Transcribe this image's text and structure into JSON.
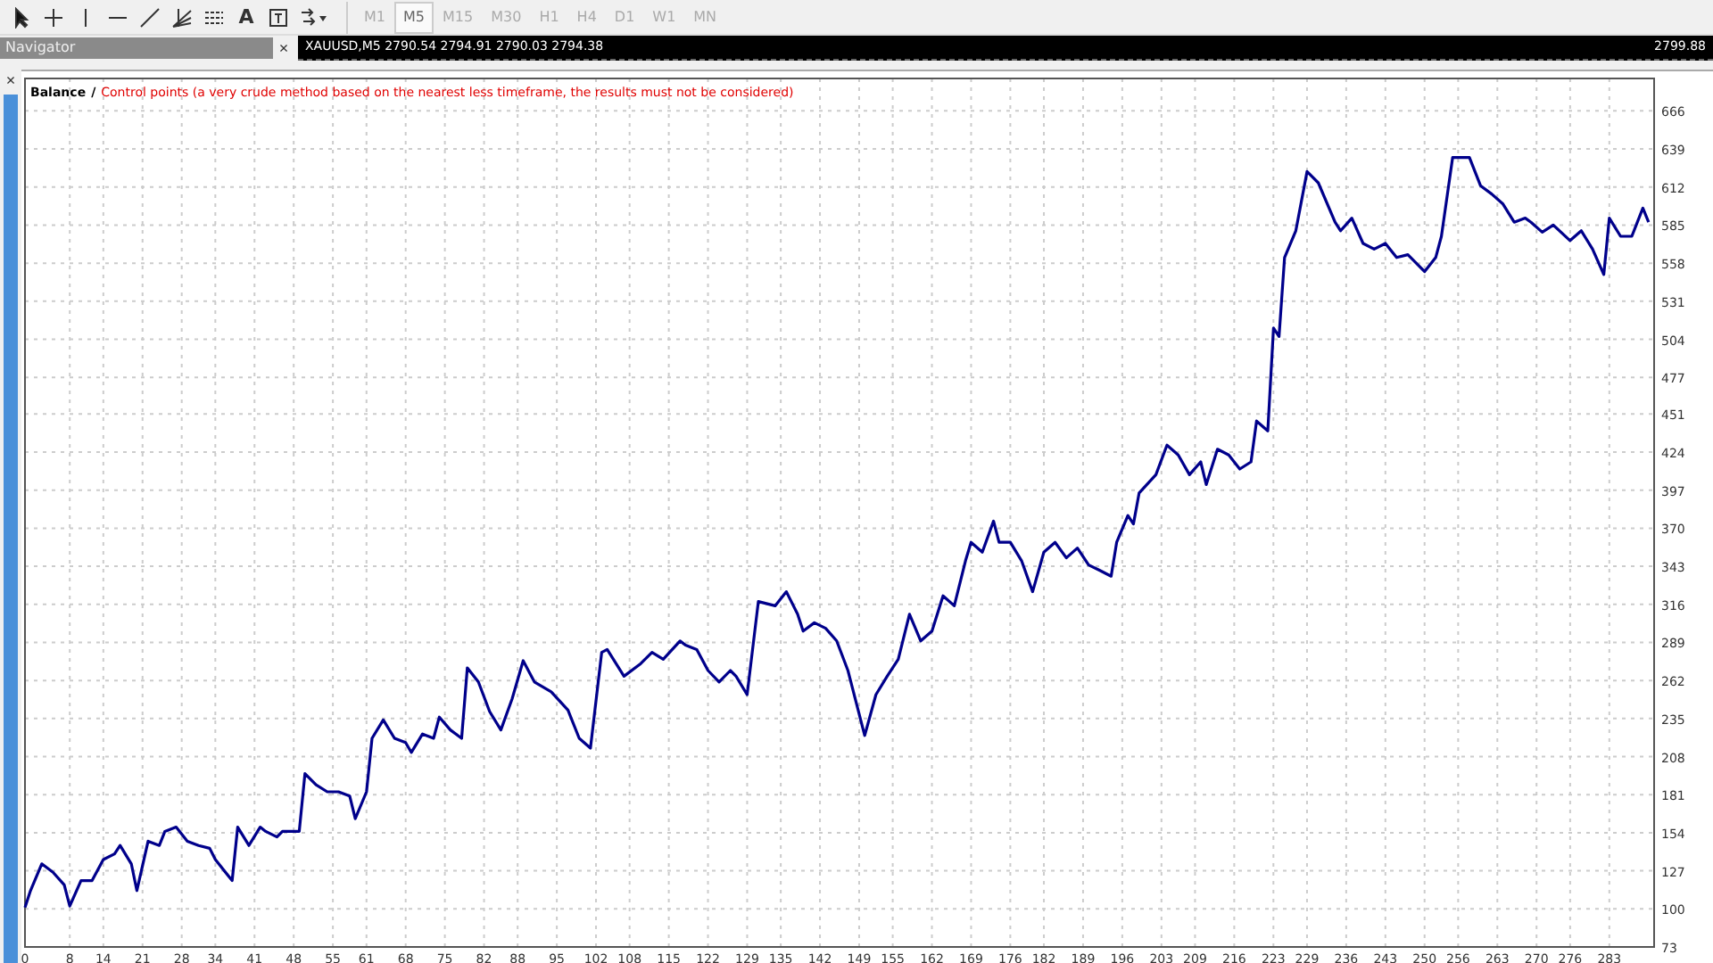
{
  "toolbar": {
    "tools": [
      {
        "kind": "cursor"
      },
      {
        "kind": "crosshair"
      },
      {
        "kind": "vline"
      },
      {
        "kind": "hline"
      },
      {
        "kind": "trend"
      },
      {
        "kind": "fibo"
      },
      {
        "kind": "channel"
      },
      {
        "kind": "text",
        "label": "A"
      },
      {
        "kind": "label"
      },
      {
        "kind": "arrows"
      }
    ],
    "timeframes": [
      {
        "label": "M1",
        "selected": false
      },
      {
        "label": "M5",
        "selected": true
      },
      {
        "label": "M15",
        "selected": false
      },
      {
        "label": "M30",
        "selected": false
      },
      {
        "label": "H1",
        "selected": false
      },
      {
        "label": "H4",
        "selected": false
      },
      {
        "label": "D1",
        "selected": false
      },
      {
        "label": "W1",
        "selected": false
      },
      {
        "label": "MN",
        "selected": false
      }
    ]
  },
  "navigator": {
    "title": "Navigator",
    "close": "×"
  },
  "chart_window": {
    "title": "XAUUSD,M5  2790.54 2794.91 2790.03 2794.38",
    "price": "2799.88"
  },
  "side_close": "×",
  "balance_chart": {
    "legend_separator": "/",
    "legend_note": "Control points (a very crude method based on the nearest less timeframe, the results must not be considered)",
    "chart_data": {
      "type": "line",
      "grid": true,
      "xlim": [
        0,
        291
      ],
      "ylim": [
        73,
        689
      ],
      "xticks": [
        0,
        8,
        14,
        21,
        28,
        34,
        41,
        48,
        55,
        61,
        68,
        75,
        82,
        88,
        95,
        102,
        108,
        115,
        122,
        129,
        135,
        142,
        149,
        155,
        162,
        169,
        176,
        182,
        189,
        196,
        203,
        209,
        216,
        223,
        229,
        236,
        243,
        250,
        256,
        263,
        270,
        276,
        283
      ],
      "yticks": [
        73,
        100,
        127,
        154,
        181,
        208,
        235,
        262,
        289,
        316,
        343,
        370,
        397,
        424,
        451,
        477,
        504,
        531,
        558,
        585,
        612,
        639,
        666
      ],
      "x": [
        0,
        1,
        3,
        5,
        7,
        8,
        10,
        12,
        14,
        16,
        17,
        19,
        20,
        22,
        24,
        25,
        27,
        29,
        31,
        33,
        34,
        37,
        38,
        40,
        42,
        43,
        45,
        46,
        49,
        50,
        52,
        54,
        56,
        58,
        59,
        61,
        62,
        64,
        66,
        68,
        69,
        71,
        73,
        74,
        76,
        78,
        79,
        81,
        83,
        85,
        87,
        89,
        91,
        94,
        97,
        99,
        101,
        103,
        104,
        107,
        110,
        112,
        114,
        117,
        118,
        120,
        122,
        124,
        126,
        127,
        129,
        131,
        134,
        136,
        138,
        139,
        141,
        143,
        145,
        147,
        150,
        152,
        154,
        156,
        158,
        160,
        162,
        164,
        166,
        168,
        169,
        171,
        173,
        174,
        176,
        178,
        180,
        182,
        184,
        186,
        188,
        190,
        192,
        194,
        195,
        197,
        198,
        199,
        202,
        204,
        206,
        208,
        210,
        211,
        213,
        215,
        217,
        219,
        220,
        222,
        223,
        224,
        225,
        227,
        229,
        231,
        234,
        235,
        237,
        239,
        241,
        243,
        245,
        247,
        250,
        252,
        253,
        255,
        258,
        260,
        262,
        264,
        266,
        268,
        269,
        271,
        273,
        276,
        278,
        280,
        282,
        283,
        285,
        287,
        289,
        290
      ],
      "series": [
        {
          "name": "Balance",
          "color": "#00008b",
          "values": [
            101,
            113,
            132,
            126,
            117,
            102,
            120,
            120,
            135,
            139,
            145,
            132,
            113,
            148,
            145,
            155,
            158,
            148,
            145,
            143,
            135,
            120,
            158,
            145,
            158,
            155,
            151,
            155,
            155,
            196,
            188,
            183,
            183,
            180,
            164,
            183,
            221,
            234,
            221,
            218,
            211,
            224,
            221,
            236,
            227,
            221,
            271,
            261,
            240,
            227,
            249,
            276,
            261,
            254,
            241,
            221,
            214,
            282,
            284,
            265,
            274,
            282,
            277,
            290,
            287,
            284,
            269,
            261,
            269,
            265,
            252,
            318,
            315,
            325,
            309,
            297,
            303,
            299,
            290,
            269,
            223,
            252,
            265,
            277,
            309,
            290,
            297,
            322,
            315,
            347,
            360,
            353,
            375,
            360,
            360,
            347,
            325,
            353,
            360,
            349,
            356,
            344,
            340,
            336,
            360,
            379,
            373,
            395,
            408,
            429,
            422,
            408,
            417,
            401,
            426,
            422,
            412,
            417,
            446,
            439,
            512,
            506,
            562,
            581,
            623,
            615,
            587,
            581,
            590,
            572,
            568,
            572,
            562,
            564,
            552,
            562,
            577,
            633,
            633,
            613,
            607,
            600,
            587,
            590,
            587,
            580,
            585,
            574,
            581,
            568,
            550,
            590,
            577,
            577,
            597,
            587
          ]
        }
      ]
    }
  }
}
